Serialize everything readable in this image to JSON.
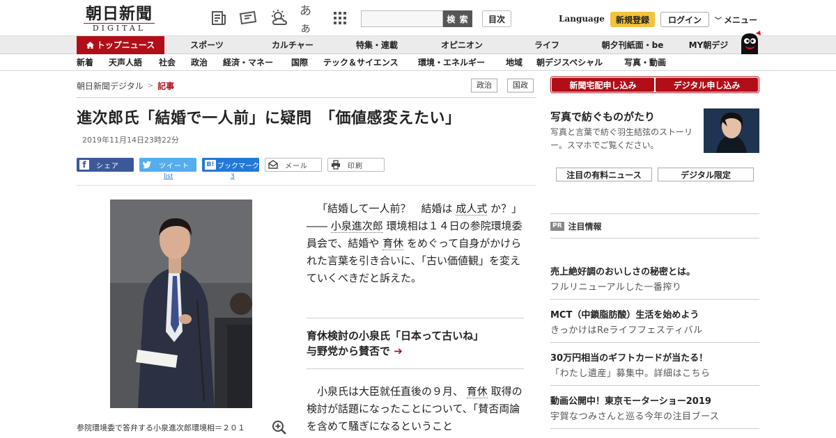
{
  "header": {
    "logo_main": "朝日新聞",
    "logo_sub": "DIGITAL",
    "aa_icon_text": "あぁ",
    "search_button": "検 索",
    "index_button": "目次",
    "language": "Language",
    "register": "新規登録",
    "login": "ログイン",
    "menu": "メニュー"
  },
  "nav": {
    "items": [
      "トップニュース",
      "スポーツ",
      "カルチャー",
      "特集・連載",
      "オピニオン",
      "ライフ",
      "朝夕刊紙面・be",
      "MY朝デジ"
    ]
  },
  "subnav": {
    "items": [
      "新着",
      "天声人語",
      "社会",
      "政治",
      "経済・マネー",
      "国際",
      "テック＆サイエンス",
      "環境・エネルギー",
      "地域",
      "朝デジスペシャル",
      "写真・動画"
    ]
  },
  "breadcrumb": {
    "root": "朝日新聞デジタル",
    "separator": ">",
    "current": "記事"
  },
  "tags": [
    "政治",
    "国政"
  ],
  "article": {
    "title": "進次郎氏「結婚で一人前」に疑問　「価値感変えたい」",
    "date": "2019年11月14日23時22分",
    "share": {
      "facebook": "シェア",
      "twitter": "ツイート",
      "hatena_icon": "B!",
      "hatena": "ブックマーク",
      "mail": "メール",
      "print": "印刷",
      "twitter_count": "list",
      "hatena_count": "3"
    },
    "caption": "参院環境委で答弁する小泉進次郎環境相＝２０１",
    "lead": {
      "p1": "「結婚して一人前？　結婚は",
      "k1": "成人式",
      "p2": "か？」――",
      "k2": "小泉進次郎",
      "p3": "環境相は１４日の参院環境委員会で、結婚や",
      "k3": "育休",
      "p4": "をめぐって自身がかけられた言葉を引き合いに、「古い価値観」を変えていくべきだと訴えた。"
    },
    "related": {
      "line1": "育休検討の小泉氏「日本って古いね」",
      "line2": "与野党から賛否で",
      "arrow": "➔"
    },
    "body2": {
      "p1": "　小泉氏は大臣就任直後の９月、",
      "k1": "育休",
      "p2": "取得の検討が話題になったことについて、「賛否両論を含めて騒ぎになるということ"
    }
  },
  "sidebar": {
    "subscribe": [
      "新聞宅配申し込み",
      "デジタル申し込み"
    ],
    "promo_title": "写真で紡ぐものがたり",
    "promo_desc": "写真と言葉で紡ぐ羽生結弦のストーリー。スマホでご覧ください。",
    "buttons": [
      "注目の有料ニュース",
      "デジタル限定"
    ],
    "pr_badge": "PR",
    "pr_title": "注目情報",
    "ads": [
      {
        "title": "売上絶好調のおいしさの秘密とは。",
        "desc": "フルリニューアルした一番搾り"
      },
      {
        "title": "MCT（中鎖脂肪酸）生活を始めよう",
        "desc": "きっかけはReライフフェスティバル"
      },
      {
        "title": "30万円相当のギフトカードが当たる！",
        "desc": "「わたし遺産」募集中。詳細はこちら"
      },
      {
        "title": "動画公開中！東京モーターショー2019",
        "desc": "宇賀なつみさんと巡る今年の注目ブース"
      }
    ]
  },
  "colors": {
    "brand_red": "#b20e18",
    "facebook": "#3b5998",
    "twitter": "#55acee",
    "hatena": "#2378d8",
    "register_yellow": "#f3c33c"
  }
}
